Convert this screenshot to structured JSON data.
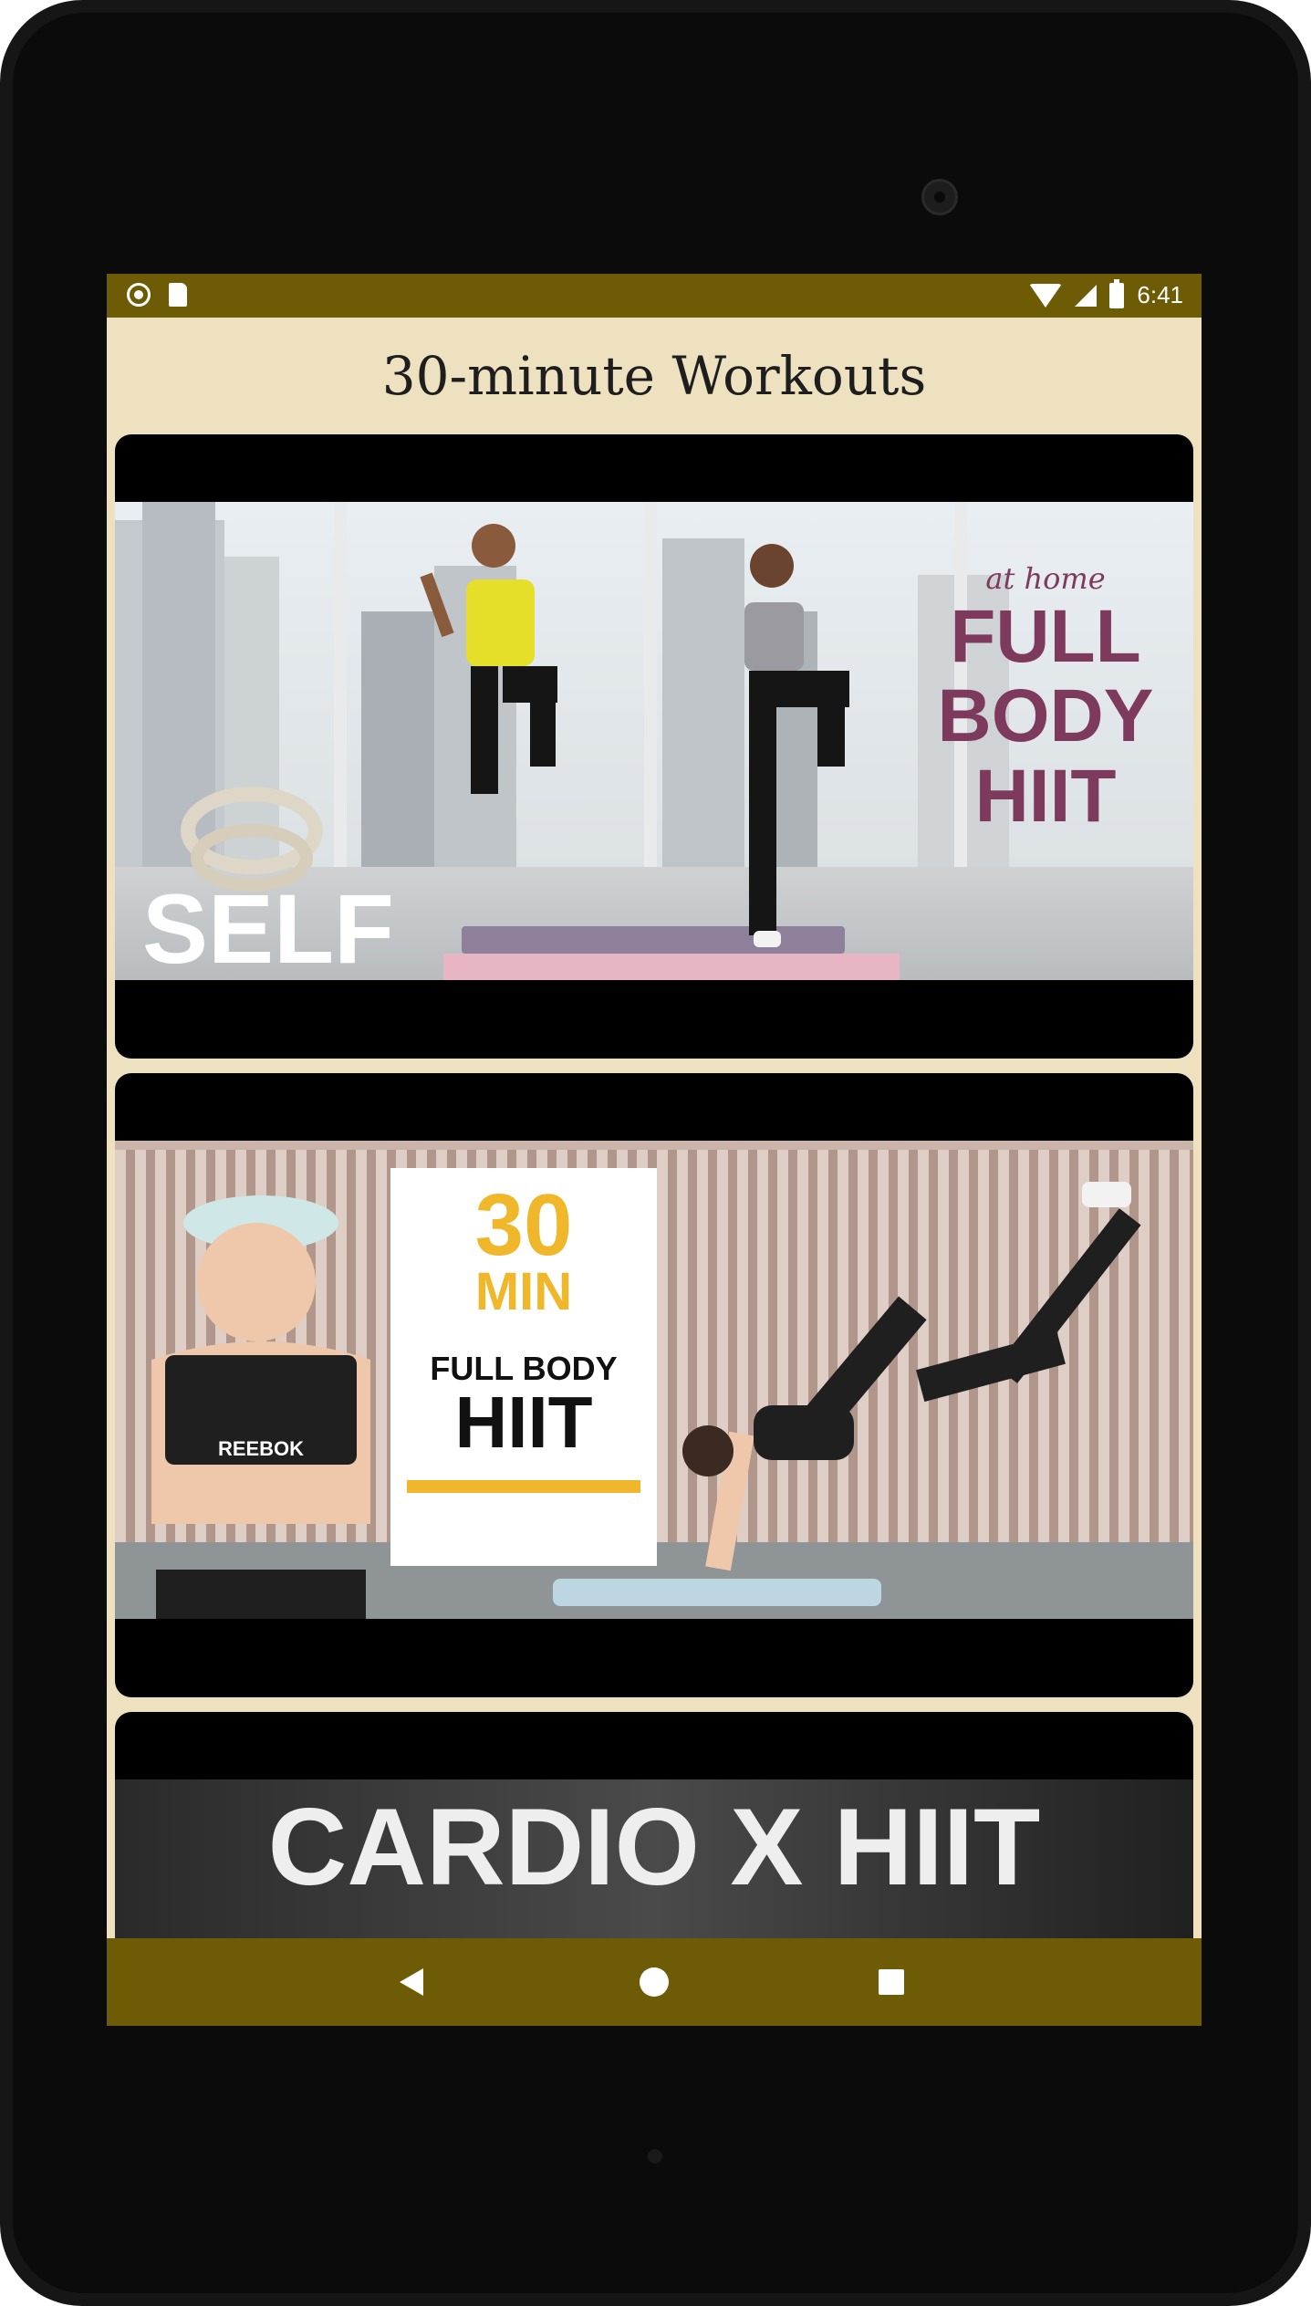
{
  "status_bar": {
    "time": "6:41",
    "icons": [
      "record-icon",
      "sd-card-icon",
      "wifi-icon",
      "signal-icon",
      "battery-icon"
    ]
  },
  "app": {
    "title": "30-minute Workouts"
  },
  "workouts": [
    {
      "brand": "SELF",
      "subtitle": "at home",
      "title_line1": "FULL",
      "title_line2": "BODY",
      "title_line3": "HIIT"
    },
    {
      "number": "30",
      "unit": "MIN",
      "title_line1": "FULL BODY",
      "title_line2": "HIIT",
      "apparel_text": "REEBOK"
    },
    {
      "title": "CARDIO X HIIT"
    }
  ],
  "nav_bar": {
    "icons": [
      "back-icon",
      "home-icon",
      "recents-icon"
    ]
  },
  "colors": {
    "status_bar": "#6d5c05",
    "background": "#ede1bf",
    "accent_magenta": "#7d3a5d",
    "accent_yellow": "#f0b72a"
  }
}
